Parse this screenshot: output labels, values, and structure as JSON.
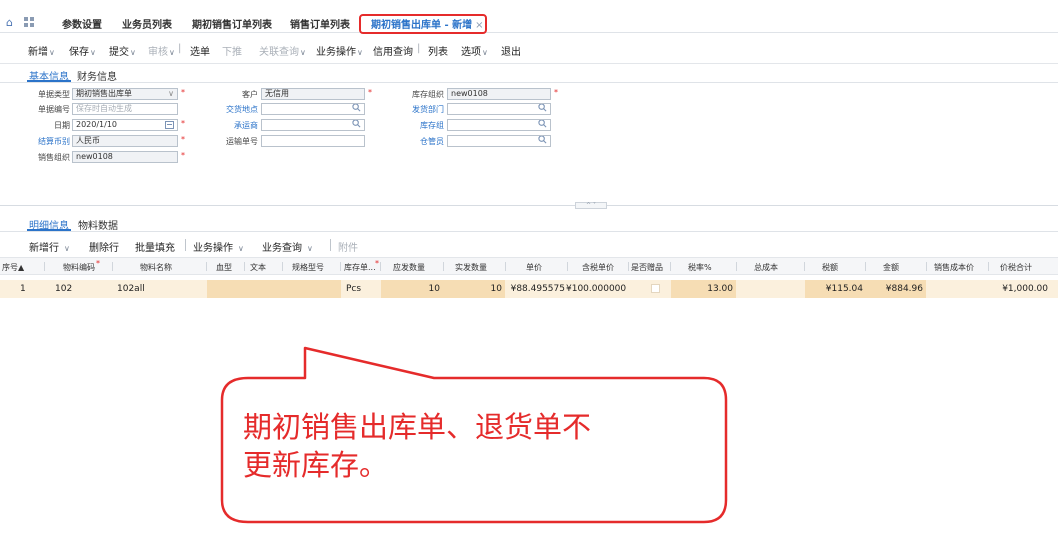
{
  "tabs": [
    {
      "label": "参数设置"
    },
    {
      "label": "业务员列表"
    },
    {
      "label": "期初销售订单列表"
    },
    {
      "label": "销售订单列表"
    },
    {
      "label": "期初销售出库单 - 新增",
      "close": "×"
    }
  ],
  "toolbar": {
    "new": "新增",
    "save": "保存",
    "submit": "提交",
    "audit": "审核",
    "select": "选单",
    "push": "下推",
    "related": "关联查询",
    "business": "业务操作",
    "credit": "信用查询",
    "list": "列表",
    "options": "选项",
    "exit": "退出",
    "caret": "∨",
    "sep": "|"
  },
  "header_tabs": {
    "basic": "基本信息",
    "finance": "财务信息"
  },
  "form": {
    "doc_type_label": "单据类型",
    "doc_type_value": "期初销售出库单",
    "doc_no_label": "单据编号",
    "doc_no_placeholder": "保存时自动生成",
    "date_label": "日期",
    "date_value": "2020/1/10",
    "currency_label": "结算币别",
    "currency_value": "人民币",
    "sales_org_label": "销售组织",
    "sales_org_value": "new0108",
    "customer_label": "客户",
    "customer_value": "无信用",
    "delivery_place_label": "交货地点",
    "carrier_label": "承运商",
    "waybill_label": "运输单号",
    "stock_org_label": "库存组织",
    "stock_org_value": "new0108",
    "ship_dept_label": "发货部门",
    "stock_group_label": "库存组",
    "keeper_label": "仓管员",
    "required_mark": "*"
  },
  "detail_tabs": {
    "detail": "明细信息",
    "material": "物料数据"
  },
  "detail_toolbar": {
    "add_row": "新增行",
    "delete_row": "删除行",
    "batch_fill": "批量填充",
    "business": "业务操作",
    "query": "业务查询",
    "attachment": "附件",
    "caret": "∨"
  },
  "grid": {
    "columns": [
      "序号▲",
      "物料编码",
      "物料名称",
      "血型",
      "文本",
      "规格型号",
      "库存单...",
      "应发数量",
      "实发数量",
      "单价",
      "含税单价",
      "是否赠品",
      "税率%",
      "总成本",
      "税额",
      "金额",
      "销售成本价",
      "价税合计"
    ],
    "rows": [
      {
        "seq": "1",
        "code": "102",
        "name": "102all",
        "unit": "Pcs",
        "qty_due": "10",
        "qty_actual": "10",
        "price": "¥88.495575",
        "tax_price": "¥100.000000",
        "tax_rate": "13.00",
        "tax": "¥115.04",
        "amount": "¥884.96",
        "total": "¥1,000.00"
      }
    ]
  },
  "callout": {
    "line1": "期初销售出库单、退货单不",
    "line2": "更新库存。"
  },
  "colors": {
    "accent": "#2b73c9",
    "callout_red": "#e52b2b",
    "row_highlight": "#fbf0dd"
  }
}
